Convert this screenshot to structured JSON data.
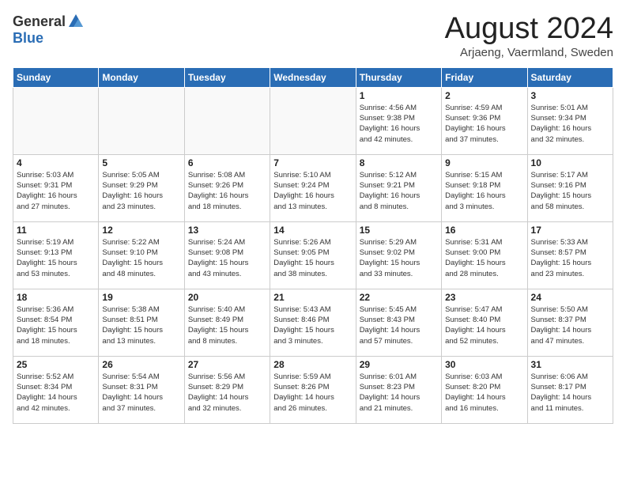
{
  "header": {
    "logo_general": "General",
    "logo_blue": "Blue",
    "month_title": "August 2024",
    "location": "Arjaeng, Vaermland, Sweden"
  },
  "weekdays": [
    "Sunday",
    "Monday",
    "Tuesday",
    "Wednesday",
    "Thursday",
    "Friday",
    "Saturday"
  ],
  "weeks": [
    [
      {
        "day": "",
        "info": ""
      },
      {
        "day": "",
        "info": ""
      },
      {
        "day": "",
        "info": ""
      },
      {
        "day": "",
        "info": ""
      },
      {
        "day": "1",
        "info": "Sunrise: 4:56 AM\nSunset: 9:38 PM\nDaylight: 16 hours\nand 42 minutes."
      },
      {
        "day": "2",
        "info": "Sunrise: 4:59 AM\nSunset: 9:36 PM\nDaylight: 16 hours\nand 37 minutes."
      },
      {
        "day": "3",
        "info": "Sunrise: 5:01 AM\nSunset: 9:34 PM\nDaylight: 16 hours\nand 32 minutes."
      }
    ],
    [
      {
        "day": "4",
        "info": "Sunrise: 5:03 AM\nSunset: 9:31 PM\nDaylight: 16 hours\nand 27 minutes."
      },
      {
        "day": "5",
        "info": "Sunrise: 5:05 AM\nSunset: 9:29 PM\nDaylight: 16 hours\nand 23 minutes."
      },
      {
        "day": "6",
        "info": "Sunrise: 5:08 AM\nSunset: 9:26 PM\nDaylight: 16 hours\nand 18 minutes."
      },
      {
        "day": "7",
        "info": "Sunrise: 5:10 AM\nSunset: 9:24 PM\nDaylight: 16 hours\nand 13 minutes."
      },
      {
        "day": "8",
        "info": "Sunrise: 5:12 AM\nSunset: 9:21 PM\nDaylight: 16 hours\nand 8 minutes."
      },
      {
        "day": "9",
        "info": "Sunrise: 5:15 AM\nSunset: 9:18 PM\nDaylight: 16 hours\nand 3 minutes."
      },
      {
        "day": "10",
        "info": "Sunrise: 5:17 AM\nSunset: 9:16 PM\nDaylight: 15 hours\nand 58 minutes."
      }
    ],
    [
      {
        "day": "11",
        "info": "Sunrise: 5:19 AM\nSunset: 9:13 PM\nDaylight: 15 hours\nand 53 minutes."
      },
      {
        "day": "12",
        "info": "Sunrise: 5:22 AM\nSunset: 9:10 PM\nDaylight: 15 hours\nand 48 minutes."
      },
      {
        "day": "13",
        "info": "Sunrise: 5:24 AM\nSunset: 9:08 PM\nDaylight: 15 hours\nand 43 minutes."
      },
      {
        "day": "14",
        "info": "Sunrise: 5:26 AM\nSunset: 9:05 PM\nDaylight: 15 hours\nand 38 minutes."
      },
      {
        "day": "15",
        "info": "Sunrise: 5:29 AM\nSunset: 9:02 PM\nDaylight: 15 hours\nand 33 minutes."
      },
      {
        "day": "16",
        "info": "Sunrise: 5:31 AM\nSunset: 9:00 PM\nDaylight: 15 hours\nand 28 minutes."
      },
      {
        "day": "17",
        "info": "Sunrise: 5:33 AM\nSunset: 8:57 PM\nDaylight: 15 hours\nand 23 minutes."
      }
    ],
    [
      {
        "day": "18",
        "info": "Sunrise: 5:36 AM\nSunset: 8:54 PM\nDaylight: 15 hours\nand 18 minutes."
      },
      {
        "day": "19",
        "info": "Sunrise: 5:38 AM\nSunset: 8:51 PM\nDaylight: 15 hours\nand 13 minutes."
      },
      {
        "day": "20",
        "info": "Sunrise: 5:40 AM\nSunset: 8:49 PM\nDaylight: 15 hours\nand 8 minutes."
      },
      {
        "day": "21",
        "info": "Sunrise: 5:43 AM\nSunset: 8:46 PM\nDaylight: 15 hours\nand 3 minutes."
      },
      {
        "day": "22",
        "info": "Sunrise: 5:45 AM\nSunset: 8:43 PM\nDaylight: 14 hours\nand 57 minutes."
      },
      {
        "day": "23",
        "info": "Sunrise: 5:47 AM\nSunset: 8:40 PM\nDaylight: 14 hours\nand 52 minutes."
      },
      {
        "day": "24",
        "info": "Sunrise: 5:50 AM\nSunset: 8:37 PM\nDaylight: 14 hours\nand 47 minutes."
      }
    ],
    [
      {
        "day": "25",
        "info": "Sunrise: 5:52 AM\nSunset: 8:34 PM\nDaylight: 14 hours\nand 42 minutes."
      },
      {
        "day": "26",
        "info": "Sunrise: 5:54 AM\nSunset: 8:31 PM\nDaylight: 14 hours\nand 37 minutes."
      },
      {
        "day": "27",
        "info": "Sunrise: 5:56 AM\nSunset: 8:29 PM\nDaylight: 14 hours\nand 32 minutes."
      },
      {
        "day": "28",
        "info": "Sunrise: 5:59 AM\nSunset: 8:26 PM\nDaylight: 14 hours\nand 26 minutes."
      },
      {
        "day": "29",
        "info": "Sunrise: 6:01 AM\nSunset: 8:23 PM\nDaylight: 14 hours\nand 21 minutes."
      },
      {
        "day": "30",
        "info": "Sunrise: 6:03 AM\nSunset: 8:20 PM\nDaylight: 14 hours\nand 16 minutes."
      },
      {
        "day": "31",
        "info": "Sunrise: 6:06 AM\nSunset: 8:17 PM\nDaylight: 14 hours\nand 11 minutes."
      }
    ]
  ]
}
